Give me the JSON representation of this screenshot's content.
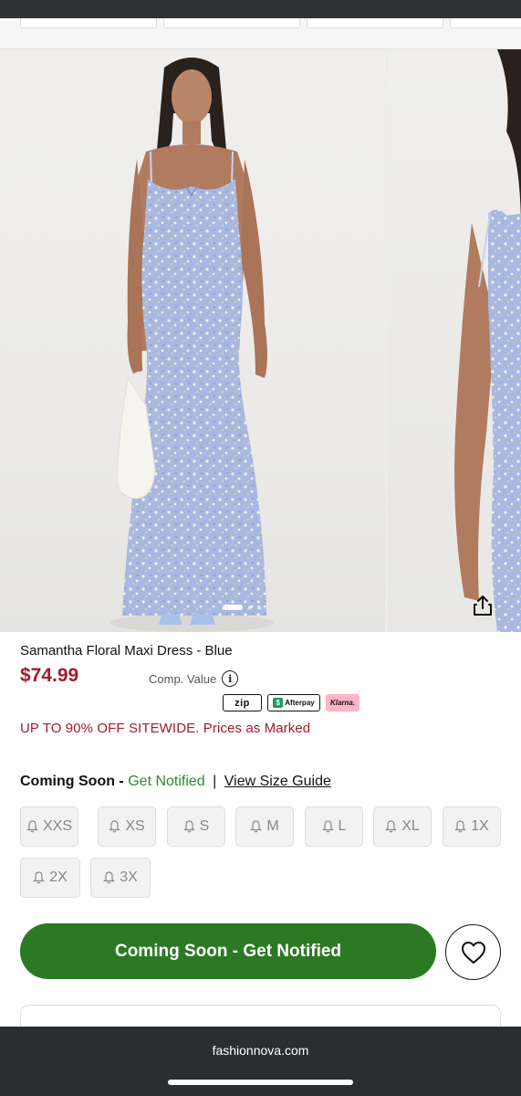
{
  "browser": {
    "domain": "fashionnova.com"
  },
  "gallery": {
    "slide_count": 3,
    "active_slide": 1,
    "share_icon": "share-icon"
  },
  "product": {
    "title": "Samantha Floral Maxi Dress - Blue",
    "price": "$74.99",
    "comp_value_label": "Comp. Value",
    "comp_info_icon": "i",
    "payments": {
      "zip": "zip",
      "afterpay": "Afterpay",
      "klarna": "Klarna."
    },
    "promo": "UP TO 90% OFF SITEWIDE. Prices as Marked"
  },
  "availability": {
    "coming_soon": "Coming Soon -",
    "get_notified": "Get Notified",
    "separator": "|",
    "size_guide": "View Size Guide"
  },
  "sizes": [
    "XXS",
    "XS",
    "S",
    "M",
    "L",
    "XL",
    "1X",
    "2X",
    "3X"
  ],
  "cta": {
    "label": "Coming Soon - Get Notified"
  },
  "colors": {
    "price": "#a31c2b",
    "accent_green": "#2b7a23",
    "link_green": "#2b8a2e",
    "dress": "#a9b8e0"
  }
}
